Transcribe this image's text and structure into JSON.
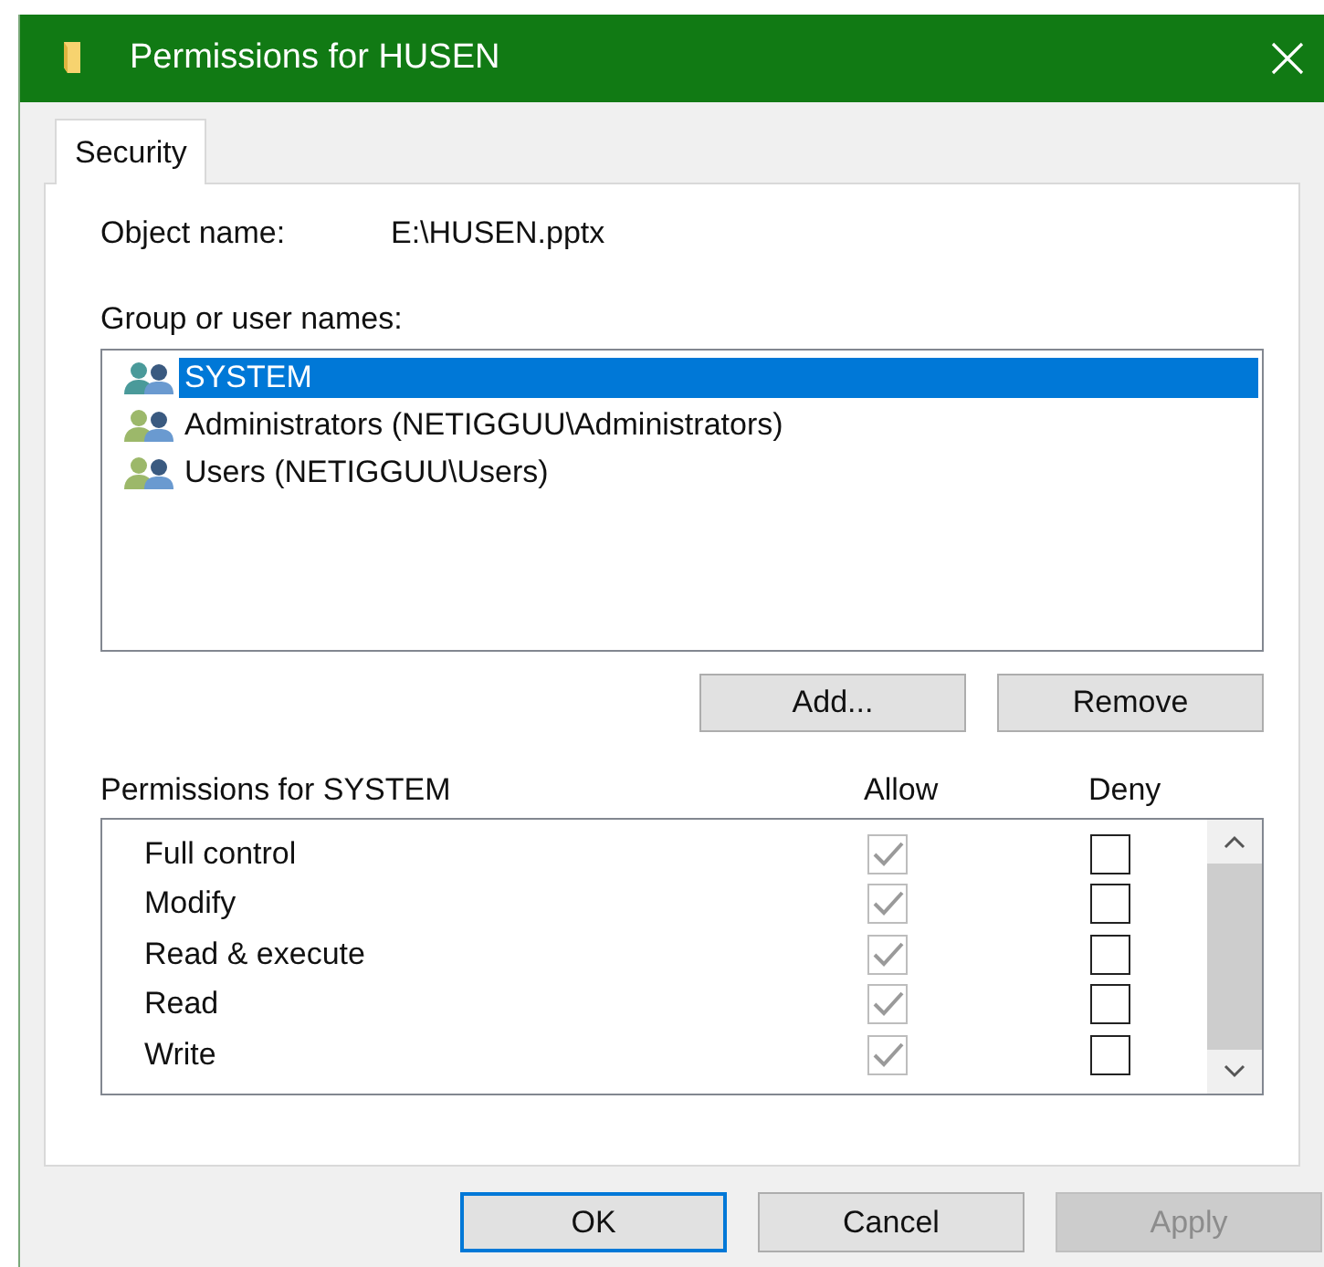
{
  "window": {
    "title": "Permissions for HUSEN"
  },
  "tabs": [
    {
      "label": "Security",
      "selected": true
    }
  ],
  "object": {
    "label": "Object name:",
    "value": "E:\\HUSEN.pptx"
  },
  "group_label": "Group or user names:",
  "users": [
    {
      "name": "SYSTEM",
      "selected": true
    },
    {
      "name": "Administrators (NETIGGUU\\Administrators)",
      "selected": false
    },
    {
      "name": "Users (NETIGGUU\\Users)",
      "selected": false
    }
  ],
  "user_buttons": [
    {
      "label": "Add...",
      "disabled": false
    },
    {
      "label": "Remove",
      "disabled": false
    }
  ],
  "permissions": {
    "title": "Permissions for SYSTEM",
    "allow_label": "Allow",
    "deny_label": "Deny",
    "rows": [
      {
        "name": "Full control",
        "allow": {
          "checked": true,
          "disabled": true
        },
        "deny": {
          "checked": false,
          "disabled": false
        }
      },
      {
        "name": "Modify",
        "allow": {
          "checked": true,
          "disabled": true
        },
        "deny": {
          "checked": false,
          "disabled": false
        }
      },
      {
        "name": "Read & execute",
        "allow": {
          "checked": true,
          "disabled": true
        },
        "deny": {
          "checked": false,
          "disabled": false
        }
      },
      {
        "name": "Read",
        "allow": {
          "checked": true,
          "disabled": true
        },
        "deny": {
          "checked": false,
          "disabled": false
        }
      },
      {
        "name": "Write",
        "allow": {
          "checked": true,
          "disabled": true
        },
        "deny": {
          "checked": false,
          "disabled": false
        }
      }
    ]
  },
  "buttons": [
    {
      "label": "OK",
      "default": true,
      "disabled": false
    },
    {
      "label": "Cancel",
      "default": false,
      "disabled": false
    },
    {
      "label": "Apply",
      "default": false,
      "disabled": true
    }
  ]
}
